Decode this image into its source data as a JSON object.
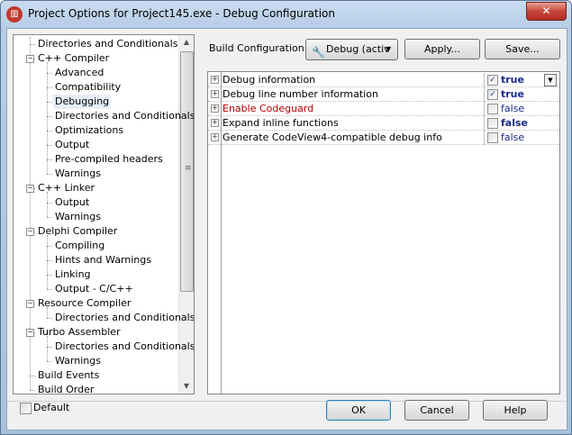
{
  "window": {
    "title": "Project Options for Project145.exe - Debug Configuration",
    "close_glyph": "✕",
    "app_icon_glyph": "▥"
  },
  "tree": {
    "items": [
      {
        "label": "Directories and Conditionals",
        "level": 0
      },
      {
        "label": "C++ Compiler",
        "level": 0,
        "expander": "−"
      },
      {
        "label": "Advanced",
        "level": 1
      },
      {
        "label": "Compatibility",
        "level": 1
      },
      {
        "label": "Debugging",
        "level": 1,
        "selected": true
      },
      {
        "label": "Directories and Conditionals",
        "level": 1
      },
      {
        "label": "Optimizations",
        "level": 1
      },
      {
        "label": "Output",
        "level": 1
      },
      {
        "label": "Pre-compiled headers",
        "level": 1
      },
      {
        "label": "Warnings",
        "level": 1
      },
      {
        "label": "C++ Linker",
        "level": 0,
        "expander": "−"
      },
      {
        "label": "Output",
        "level": 1
      },
      {
        "label": "Warnings",
        "level": 1
      },
      {
        "label": "Delphi Compiler",
        "level": 0,
        "expander": "−"
      },
      {
        "label": "Compiling",
        "level": 1
      },
      {
        "label": "Hints and Warnings",
        "level": 1
      },
      {
        "label": "Linking",
        "level": 1
      },
      {
        "label": "Output - C/C++",
        "level": 1
      },
      {
        "label": "Resource Compiler",
        "level": 0,
        "expander": "−"
      },
      {
        "label": "Directories and Conditionals",
        "level": 1
      },
      {
        "label": "Turbo Assembler",
        "level": 0,
        "expander": "−"
      },
      {
        "label": "Directories and Conditionals",
        "level": 1
      },
      {
        "label": "Warnings",
        "level": 1
      },
      {
        "label": "Build Events",
        "level": 0
      },
      {
        "label": "Build Order",
        "level": 0
      }
    ],
    "scroll_up": "▲",
    "scroll_down": "▼",
    "grip": "≡"
  },
  "build": {
    "label": "Build Configuration:",
    "combo_value": "Debug (activ",
    "combo_icon": "🔧",
    "combo_arrow": "▼",
    "apply_label": "Apply...",
    "save_label": "Save..."
  },
  "grid": {
    "expander": "+",
    "check_mark": "✓",
    "dropdown_arrow": "▼",
    "rows": [
      {
        "name": "Debug information",
        "checked": true,
        "value": "true",
        "bold": true,
        "modified": false,
        "dropdown": true
      },
      {
        "name": "Debug line number information",
        "checked": true,
        "value": "true",
        "bold": true,
        "modified": false
      },
      {
        "name": "Enable Codeguard",
        "checked": false,
        "value": "false",
        "bold": false,
        "modified": true
      },
      {
        "name": "Expand inline functions",
        "checked": false,
        "value": "false",
        "bold": true,
        "modified": false
      },
      {
        "name": "Generate CodeView4-compatible debug info",
        "checked": false,
        "value": "false",
        "bold": false,
        "modified": false
      }
    ]
  },
  "footer": {
    "default_label": "Default",
    "ok_label": "OK",
    "cancel_label": "Cancel",
    "help_label": "Help"
  }
}
